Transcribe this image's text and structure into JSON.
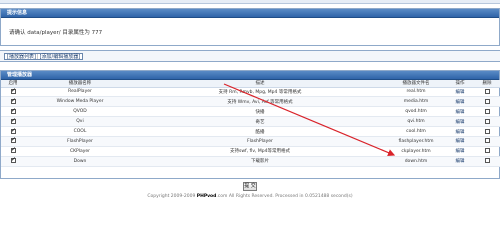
{
  "notice": {
    "header": "提示信息",
    "message": "请确认 data/player/ 目录属性为 777"
  },
  "toolbar": {
    "link_list": "[播放器列表]",
    "link_add": "[添加/编辑播放器]"
  },
  "manage": {
    "header": "管理播放器",
    "columns": [
      "启用",
      "播放器名称",
      "描述",
      "播放器文件名",
      "操作",
      "删除"
    ],
    "rows": [
      {
        "name": "RealPlayer",
        "desc": "支持 Rm, Rmvb, Mpg, Mp4 等常用格式",
        "file": "real.htm",
        "action": "编辑",
        "enabled": true
      },
      {
        "name": "Window Meda Player",
        "desc": "支持 Wmv, Avi, Asf 等常用格式",
        "file": "media.htm",
        "action": "编辑",
        "enabled": true
      },
      {
        "name": "QVOD",
        "desc": "快播",
        "file": "qvod.htm",
        "action": "编辑",
        "enabled": true
      },
      {
        "name": "Qvi",
        "desc": "奇艺",
        "file": "qvi.htm",
        "action": "编辑",
        "enabled": true
      },
      {
        "name": "COOL",
        "desc": "酷播",
        "file": "cool.htm",
        "action": "编辑",
        "enabled": true
      },
      {
        "name": "FlashPlayer",
        "desc": "FlashPlayer",
        "file": "flashplayer.htm",
        "action": "编辑",
        "enabled": true
      },
      {
        "name": "CKPlayer",
        "desc": "支持swf, flv, Mp4等常用格式",
        "file": "ckplayer.htm",
        "action": "编辑",
        "enabled": true
      },
      {
        "name": "Down",
        "desc": "下载影片",
        "file": "down.htm",
        "action": "编辑",
        "enabled": true
      }
    ]
  },
  "submit_label": "提 交",
  "footer": {
    "prefix": "Copyright 2009-2009",
    "brand": "PHPvod",
    "suffix": ".com All Rights Reserved. Processed in 0.0521488 second(s)"
  },
  "colors": {
    "header": "#2f64a8",
    "arrow": "#d9232a"
  }
}
